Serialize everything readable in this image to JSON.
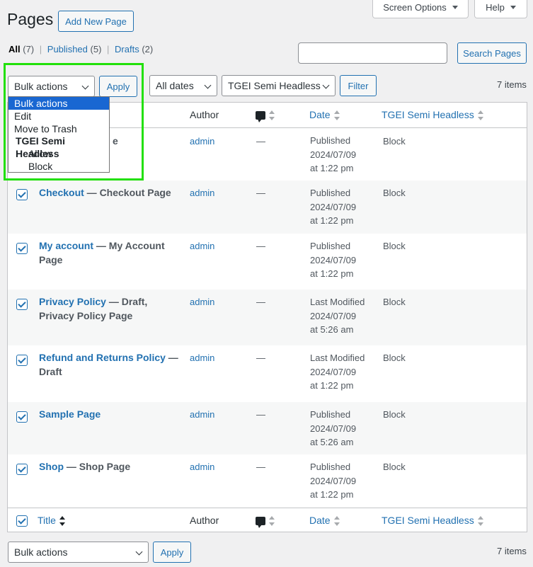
{
  "header": {
    "screen_options": "Screen Options",
    "help": "Help",
    "title": "Pages",
    "add_new": "Add New Page"
  },
  "views": [
    {
      "label": "All",
      "count": "(7)"
    },
    {
      "label": "Published",
      "count": "(5)"
    },
    {
      "label": "Drafts",
      "count": "(2)"
    }
  ],
  "search": {
    "value": "",
    "button": "Search Pages"
  },
  "tablenav_top": {
    "bulk_select": "Bulk actions",
    "apply": "Apply",
    "dates": "All dates",
    "tgei_filter": "TGEI Semi Headless",
    "filter": "Filter",
    "items": "7 items"
  },
  "bulk_dropdown": {
    "options": [
      "Bulk actions",
      "Edit",
      "Move to Trash"
    ],
    "group_label": "TGEI Semi Headless",
    "group_options": [
      "Allow",
      "Block"
    ],
    "selected": "Bulk actions"
  },
  "columns": {
    "title": "Title",
    "author": "Author",
    "date": "Date",
    "tgei": "TGEI Semi Headless"
  },
  "rows": [
    {
      "title": "",
      "suffix": "e",
      "author": "admin",
      "comments": "—",
      "status": "Published",
      "date": "2024/07/09",
      "time": "at 1:22 pm",
      "tgei": "Block"
    },
    {
      "title": "Checkout",
      "suffix": " — Checkout Page",
      "author": "admin",
      "comments": "—",
      "status": "Published",
      "date": "2024/07/09",
      "time": "at 1:22 pm",
      "tgei": "Block"
    },
    {
      "title": "My account",
      "suffix": " — My Account Page",
      "author": "admin",
      "comments": "—",
      "status": "Published",
      "date": "2024/07/09",
      "time": "at 1:22 pm",
      "tgei": "Block"
    },
    {
      "title": "Privacy Policy",
      "suffix": " — Draft, Privacy Policy Page",
      "author": "admin",
      "comments": "—",
      "status": "Last Modified",
      "date": "2024/07/09",
      "time": "at 5:26 am",
      "tgei": "Block"
    },
    {
      "title": "Refund and Returns Policy",
      "suffix": " — Draft",
      "author": "admin",
      "comments": "—",
      "status": "Last Modified",
      "date": "2024/07/09",
      "time": "at 1:22 pm",
      "tgei": "Block"
    },
    {
      "title": "Sample Page",
      "suffix": "",
      "author": "admin",
      "comments": "—",
      "status": "Published",
      "date": "2024/07/09",
      "time": "at 5:26 am",
      "tgei": "Block"
    },
    {
      "title": "Shop",
      "suffix": " — Shop Page",
      "author": "admin",
      "comments": "—",
      "status": "Published",
      "date": "2024/07/09",
      "time": "at 1:22 pm",
      "tgei": "Block"
    }
  ],
  "tablenav_bottom": {
    "bulk_select": "Bulk actions",
    "apply": "Apply",
    "items": "7 items"
  },
  "colors": {
    "link": "#2271b1",
    "highlight": "#22e00a",
    "selected_option": "#1967d2"
  }
}
